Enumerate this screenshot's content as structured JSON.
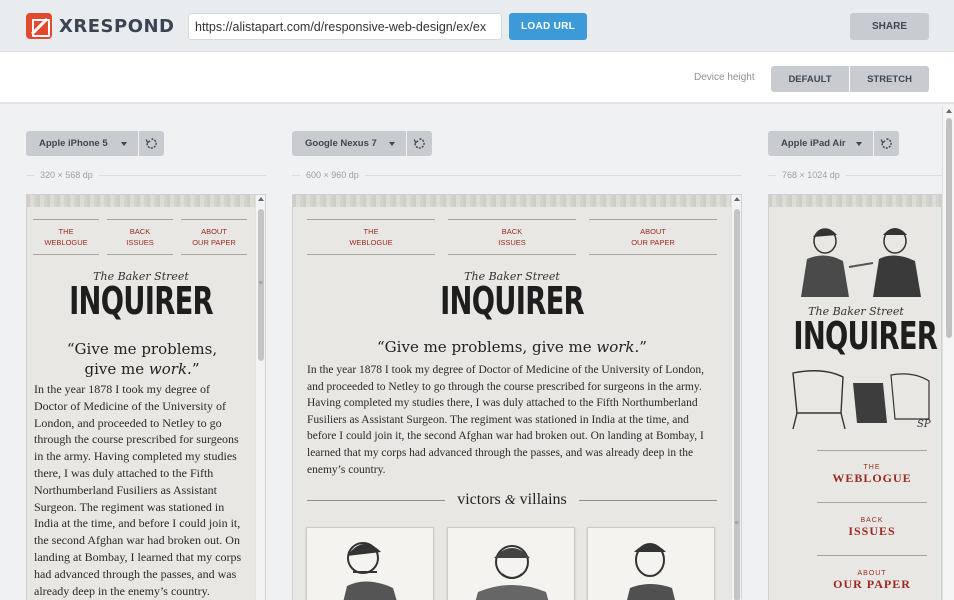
{
  "app": {
    "name": "XRESPOND"
  },
  "toolbar": {
    "url_value": "https://alistapart.com/d/responsive-web-design/ex/ex",
    "load_label": "LOAD URL",
    "share_label": "SHARE"
  },
  "device_height": {
    "label": "Device height",
    "default_label": "DEFAULT",
    "stretch_label": "STRETCH"
  },
  "devices": [
    {
      "name": "Apple iPhone 5",
      "dims": "320 × 568 dp"
    },
    {
      "name": "Google Nexus 7",
      "dims": "600 × 960 dp"
    },
    {
      "name": "Apple iPad Air",
      "dims": "768 × 1024 dp"
    }
  ],
  "site": {
    "nav": [
      {
        "line1": "THE",
        "line2": "WEBLOGUE"
      },
      {
        "line1": "BACK",
        "line2": "ISSUES"
      },
      {
        "line1": "ABOUT",
        "line2": "OUR PAPER"
      }
    ],
    "brand_pre": "The Baker Street",
    "brand_main": "INQUIRER",
    "quote_start": "“Give me problems, give me",
    "quote_em": "work.",
    "quote_end": "”",
    "body": "In the year 1878 I took my degree of Doctor of Medicine of the University of London, and proceeded to Netley to go through the course prescribed for surgeons in the army. Having completed my studies there, I was duly attached to the Fifth Northumberland Fusiliers as Assistant Surgeon. The regiment was stationed in India at the time, and before I could join it, the second Afghan war had broken out. On landing at Bombay, I learned that my corps had advanced through the passes, and was already deep in the enemy’s country.",
    "section_title_a": "victors",
    "section_amp": "&",
    "section_title_b": "villains",
    "illustration_signature": "SP"
  },
  "colors": {
    "accent": "#3d9ad8",
    "brand_red": "#e2492f",
    "link_red": "#9b2a22"
  },
  "icons": [
    "xrespond-logo-icon",
    "caret-down-icon",
    "rotate-icon"
  ]
}
